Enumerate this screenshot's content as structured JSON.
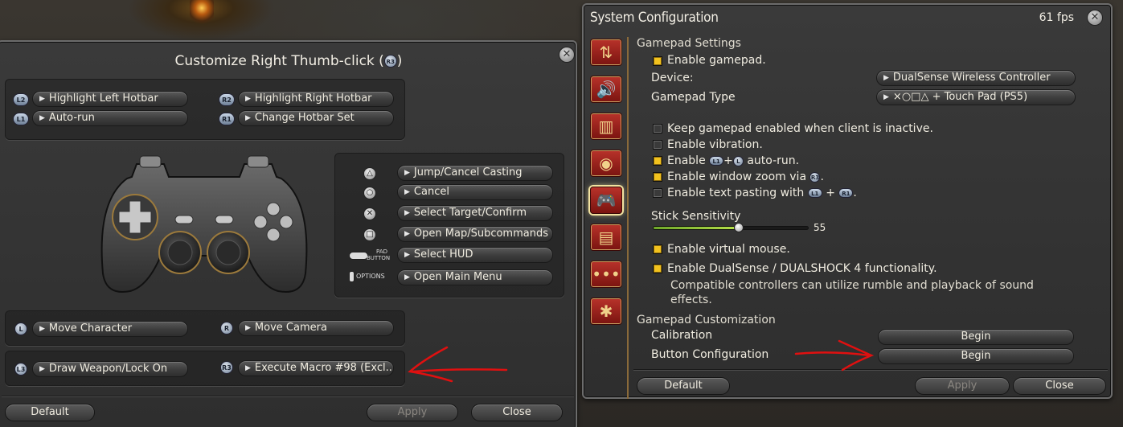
{
  "left_window": {
    "title": "Customize Right Thumb-click (",
    "title_badge": "R3",
    "title_end": ")",
    "top_bindings": [
      {
        "badge": "L2",
        "label": "Highlight Left Hotbar"
      },
      {
        "badge": "R2",
        "label": "Highlight Right Hotbar"
      },
      {
        "badge": "L1",
        "label": "Auto-run"
      },
      {
        "badge": "R1",
        "label": "Change Hotbar Set"
      }
    ],
    "face_bindings": [
      {
        "icon": "triangle-icon",
        "label": "Jump/Cancel Casting"
      },
      {
        "icon": "circle-icon",
        "label": "Cancel"
      },
      {
        "icon": "cross-icon",
        "label": "Select Target/Confirm"
      },
      {
        "icon": "square-icon",
        "label": "Open Map/Subcommands"
      },
      {
        "icon": "pad-button-icon",
        "label": "Select HUD",
        "icon_text": "PAD BUTTON"
      },
      {
        "icon": "options-icon",
        "label": "Open Main Menu",
        "icon_text": "OPTIONS"
      }
    ],
    "stick_bindings": [
      {
        "badge": "L",
        "label": "Move Character"
      },
      {
        "badge": "R",
        "label": "Move Camera"
      }
    ],
    "click_bindings": [
      {
        "badge": "L3",
        "label": "Draw Weapon/Lock On"
      },
      {
        "badge": "R3",
        "label": "Execute Macro #98 (Excl..."
      }
    ],
    "footer": {
      "default": "Default",
      "apply": "Apply",
      "close": "Close"
    }
  },
  "right_window": {
    "title": "System Configuration",
    "fps": "61 fps",
    "section_gamepad_settings": "Gamepad Settings",
    "enable_gamepad": "Enable gamepad.",
    "device_label": "Device:",
    "device_value": "DualSense Wireless Controller",
    "gamepad_type_label": "Gamepad Type",
    "gamepad_type_value": "×○□△ + Touch Pad (PS5)",
    "keep_enabled": "Keep gamepad enabled when client is inactive.",
    "enable_vibration": "Enable vibration.",
    "enable_autorun_pre": "Enable",
    "enable_autorun_b1": "L1",
    "enable_autorun_plus": "+",
    "enable_autorun_b2": "L",
    "enable_autorun_post": "auto-run.",
    "window_zoom_pre": "Enable window zoom via",
    "window_zoom_badge": "R3",
    "window_zoom_post": ".",
    "text_pasting_pre": "Enable text pasting with",
    "text_pasting_b1": "L1",
    "text_pasting_plus": "+",
    "text_pasting_b2": "R1",
    "text_pasting_post": ".",
    "stick_sensitivity_label": "Stick Sensitivity",
    "stick_sensitivity_value": "55",
    "stick_sensitivity_fraction": 0.55,
    "virtual_mouse": "Enable virtual mouse.",
    "dualsense": "Enable DualSense / DUALSHOCK 4 functionality.",
    "dualsense_note": "Compatible controllers can utilize rumble and playback of sound effects.",
    "section_customization": "Gamepad Customization",
    "calibration_label": "Calibration",
    "calibration_button": "Begin",
    "button_config_label": "Button Configuration",
    "button_config_button": "Begin",
    "checkbox_states": {
      "enable_gamepad": true,
      "keep_enabled": false,
      "vibration": false,
      "autorun": true,
      "window_zoom": true,
      "text_pasting": false,
      "virtual_mouse": true,
      "dualsense": true
    },
    "footer": {
      "default": "Default",
      "apply": "Apply",
      "close": "Close"
    },
    "nav_icons": [
      "display-settings-icon",
      "sound-settings-icon",
      "hotbar-settings-icon",
      "mouse-settings-icon",
      "gamepad-settings-icon",
      "log-settings-icon",
      "other-settings-icon",
      "accessibility-icon"
    ]
  },
  "colors": {
    "checkbox_on": "#f2c21e",
    "nav_red": "#b8322a",
    "annotation_red": "#e01010",
    "slider_green": "#8cc63a"
  }
}
